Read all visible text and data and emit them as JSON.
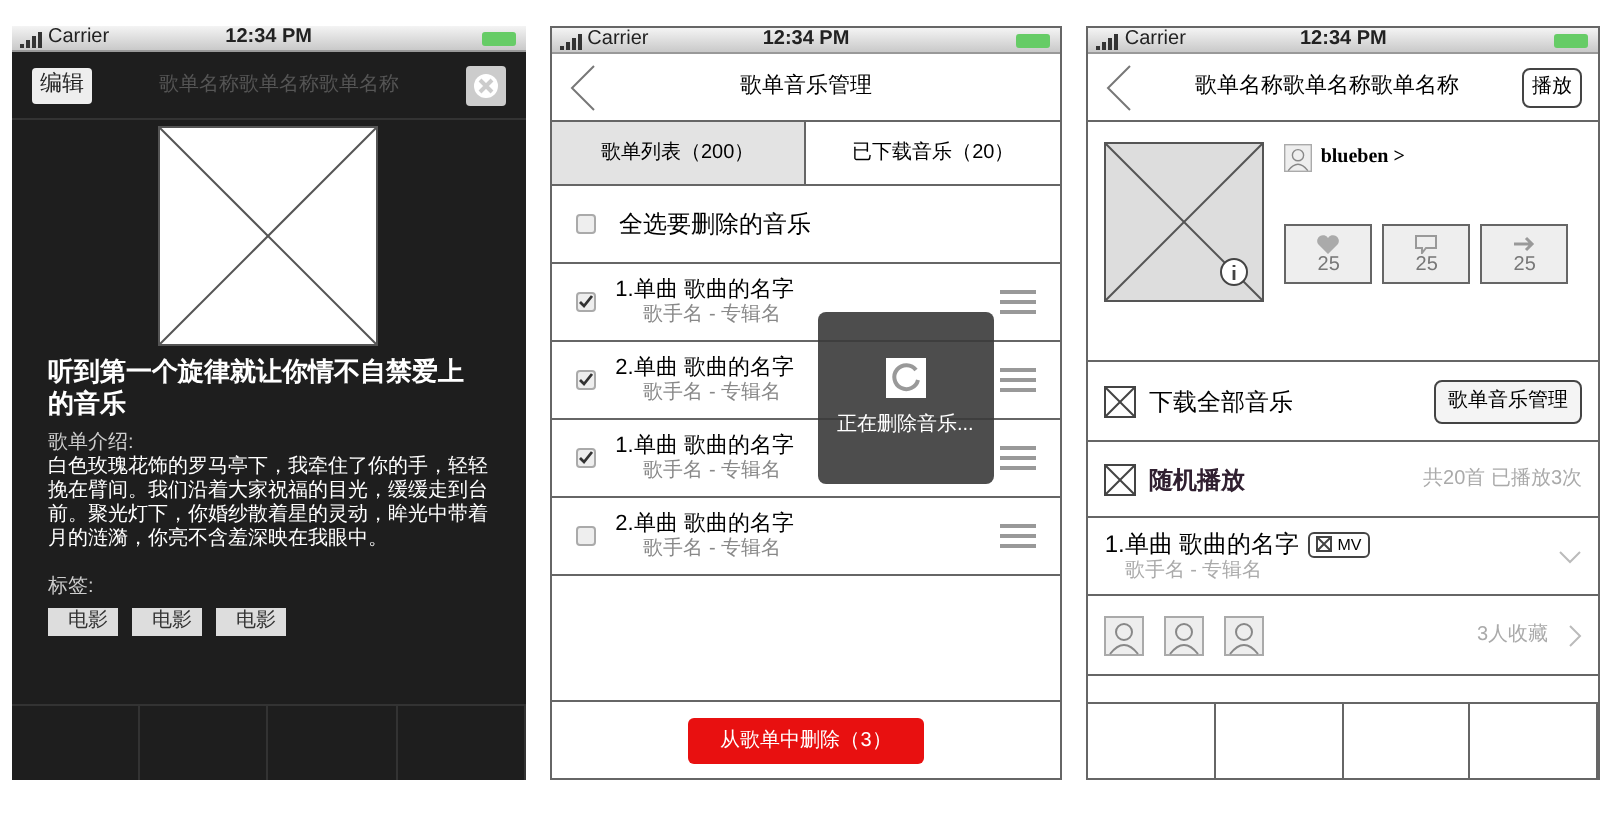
{
  "detail_screen": {
    "status_bar": {
      "carrier": "Carrier",
      "time": "12:34 PM"
    },
    "edit_button": "编辑",
    "title": "歌单名称歌单名称歌单名称",
    "heading": "听到第一个旋律就让你情不自禁爱上的音乐",
    "intro_label": "歌单介绍:",
    "intro": "白色玫瑰花饰的罗马亭下，我牵住了你的手，轻轻挽在臂间。我们沿着大家祝福的目光，缓缓走到台前。聚光灯下，你婚纱散着星的灵动，眸光中带着月的涟漪，你亮不含羞深映在我眼中。",
    "tags_label": "标签:",
    "tags": [
      "电影",
      "电影",
      "电影"
    ]
  },
  "manage_screen": {
    "status_bar": {
      "carrier": "Carrier",
      "time": "12:34 PM"
    },
    "title": "歌单音乐管理",
    "tabs": [
      {
        "label": "歌单列表（200）",
        "selected": true
      },
      {
        "label": "已下载音乐（20）",
        "selected": false
      }
    ],
    "select_all": {
      "label": "全选要删除的音乐",
      "checked": false
    },
    "songs": [
      {
        "title": "1.单曲 歌曲的名字",
        "subtitle": "歌手名 - 专辑名",
        "checked": true
      },
      {
        "title": "2.单曲 歌曲的名字",
        "subtitle": "歌手名 - 专辑名",
        "checked": true
      },
      {
        "title": "1.单曲 歌曲的名字",
        "subtitle": "歌手名 - 专辑名",
        "checked": true
      },
      {
        "title": "2.单曲 歌曲的名字",
        "subtitle": "歌手名 - 专辑名",
        "checked": false
      }
    ],
    "toast": "正在删除音乐...",
    "delete_button": "从歌单中删除（3）"
  },
  "playlist_screen": {
    "status_bar": {
      "carrier": "Carrier",
      "time": "12:34 PM"
    },
    "title": "歌单名称歌单名称歌单名称",
    "play_button": "播放",
    "user": "blueben >",
    "stats": [
      {
        "kind": "like",
        "count": "25"
      },
      {
        "kind": "comment",
        "count": "25"
      },
      {
        "kind": "share",
        "count": "25"
      }
    ],
    "download_label": "下载全部音乐",
    "manage_button": "歌单音乐管理",
    "shuffle_label": "随机播放",
    "shuffle_info": "共20首 已播放3次",
    "song": {
      "title": "1.单曲 歌曲的名字",
      "badge": "MV",
      "subtitle": "歌手名 - 专辑名"
    },
    "favorites": "3人收藏"
  }
}
